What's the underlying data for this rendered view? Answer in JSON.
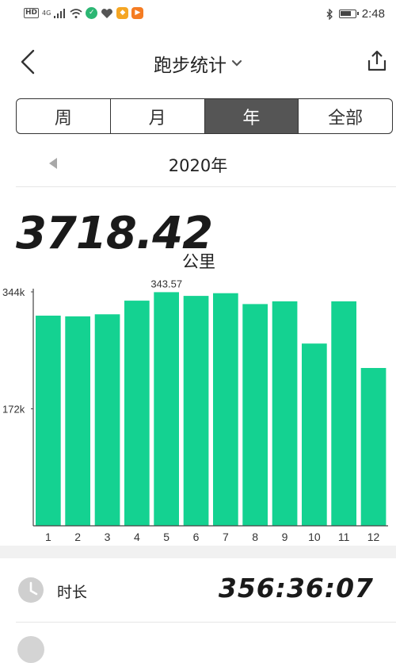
{
  "status_bar": {
    "hd": "HD",
    "signal": "4G",
    "time": "2:48",
    "icons": [
      "wifi-icon",
      "app-icon",
      "heart-icon",
      "notification-icon",
      "video-icon",
      "bluetooth-icon",
      "battery-icon"
    ]
  },
  "header": {
    "title": "跑步统计",
    "icons": [
      "back-arrow-icon",
      "chevron-down-icon",
      "share-icon"
    ]
  },
  "tabs": [
    {
      "label": "周",
      "active": false
    },
    {
      "label": "月",
      "active": false
    },
    {
      "label": "年",
      "active": true
    },
    {
      "label": "全部",
      "active": false
    }
  ],
  "year": {
    "label": "2020年",
    "prev_icon": "triangle-left-icon"
  },
  "total": {
    "value": "3718.42",
    "unit": "公里"
  },
  "colors": {
    "bar": "#14d291",
    "active_tab": "#555555",
    "axis": "#444444"
  },
  "chart_data": {
    "type": "bar",
    "categories": [
      "1",
      "2",
      "3",
      "4",
      "5",
      "6",
      "7",
      "8",
      "9",
      "10",
      "11",
      "12"
    ],
    "values": [
      309,
      308,
      311,
      331,
      343.57,
      338,
      342,
      326,
      330,
      268,
      330,
      232
    ],
    "ylim": [
      0,
      344
    ],
    "yticks": [
      {
        "value": 344,
        "label": "344k"
      },
      {
        "value": 172,
        "label": "172k"
      }
    ],
    "max_label": "343.57",
    "max_index": 4,
    "grid": false,
    "legend": "none"
  },
  "stat": {
    "icon": "clock-icon",
    "label": "时长",
    "value": "356:36:07"
  }
}
